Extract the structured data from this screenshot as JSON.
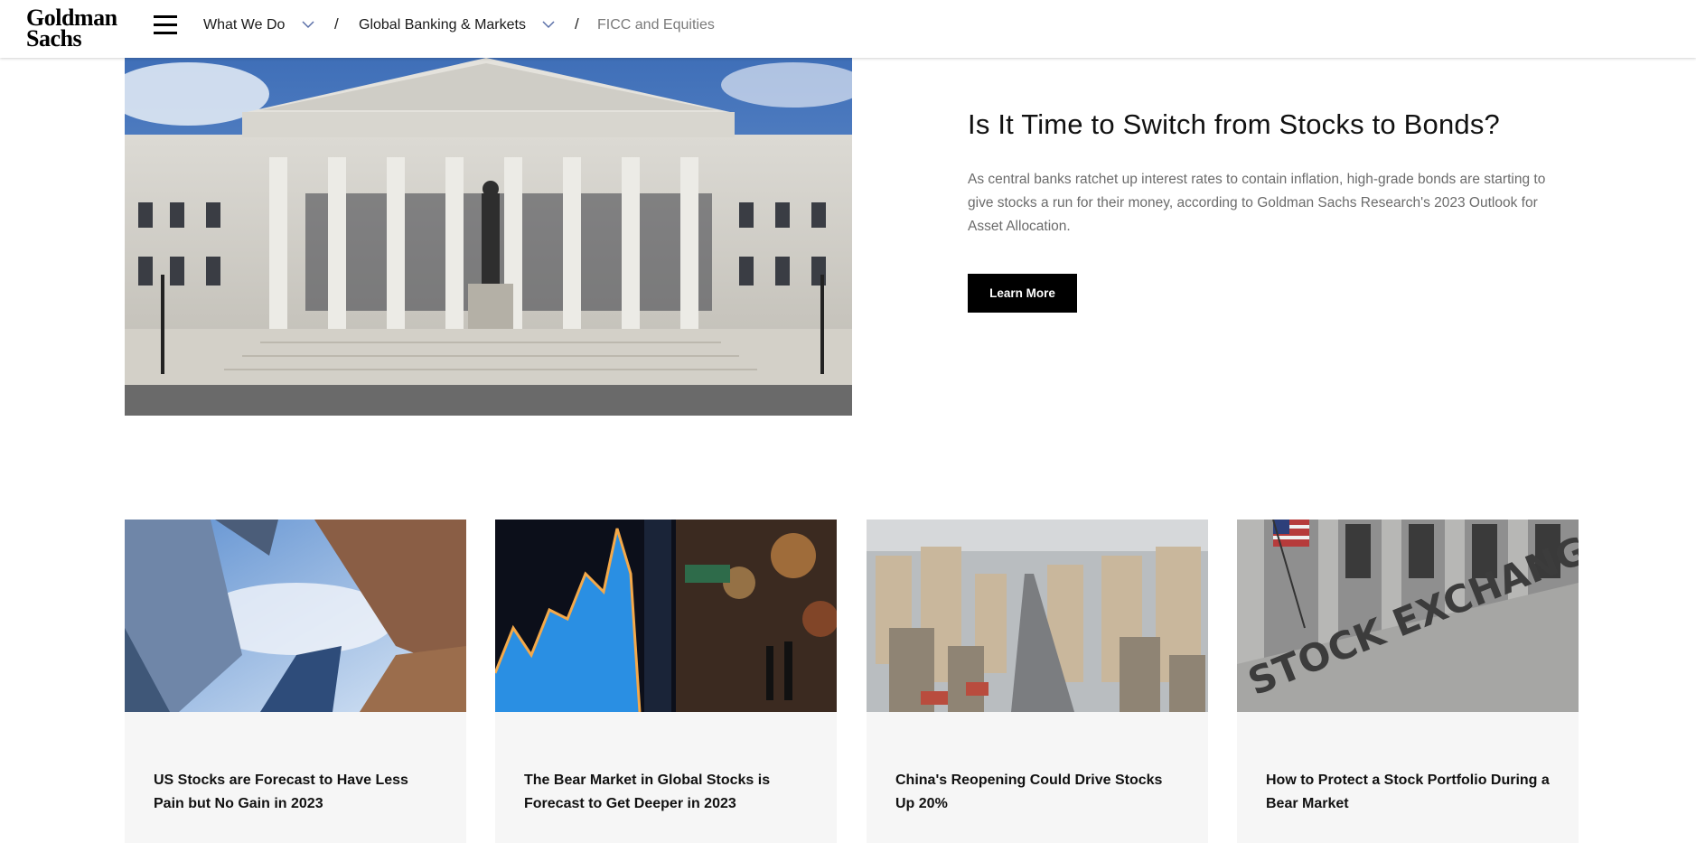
{
  "header": {
    "logo_line1": "Goldman",
    "logo_line2": "Sachs",
    "breadcrumbs": [
      {
        "label": "What We Do"
      },
      {
        "label": "Global Banking & Markets"
      },
      {
        "label": "FICC and Equities"
      }
    ],
    "separator": "/"
  },
  "hero": {
    "title": "Is It Time to Switch from Stocks to Bonds?",
    "description": "As central banks ratchet up interest rates to contain inflation, high-grade bonds are starting to give stocks a run for their money, according to Goldman Sachs Research's 2023 Outlook for Asset Allocation.",
    "button_label": "Learn More",
    "image": "treasury-building-photo"
  },
  "cards": [
    {
      "title": "US Stocks are Forecast to Have Less Pain but No Gain in 2023",
      "image": "skyscrapers-photo"
    },
    {
      "title": "The Bear Market in Global Stocks is Forecast to Get Deeper in 2023",
      "image": "stock-ticker-display-photo"
    },
    {
      "title": "China's Reopening Could Drive Stocks Up 20%",
      "image": "china-cityscape-photo"
    },
    {
      "title": "How to Protect a Stock Portfolio During a Bear Market",
      "image": "stock-exchange-building-photo"
    }
  ],
  "colors": {
    "header_bg": "#ffffff",
    "button_bg": "#000000",
    "card_bg": "#f6f6f6",
    "muted_text": "#6b6b6b"
  }
}
